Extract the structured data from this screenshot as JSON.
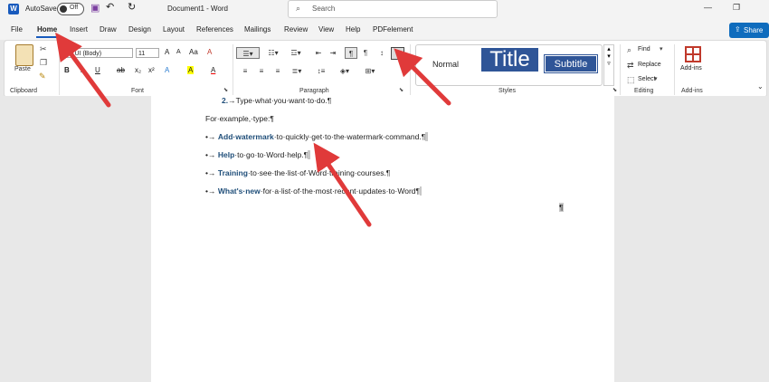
{
  "titlebar": {
    "autosave_label": "AutoSave",
    "autosave_state": "Off",
    "doc_title": "Document1 - Word",
    "search_placeholder": "Search",
    "undo": "↶",
    "redo": "↻",
    "minimize": "—",
    "restore": "❐"
  },
  "menu": {
    "tabs": [
      "File",
      "Home",
      "Insert",
      "Draw",
      "Design",
      "Layout",
      "References",
      "Mailings",
      "Review",
      "View",
      "Help",
      "PDFelement"
    ],
    "active": "Home",
    "share_label": "Share"
  },
  "ribbon": {
    "clipboard": {
      "label": "Clipboard",
      "paste_label": "Paste"
    },
    "font": {
      "label": "Font",
      "font_name": "Se UI (Body)",
      "font_size": "11",
      "buttons": [
        "B",
        "I",
        "U",
        "ab",
        "x₂",
        "x²",
        "A",
        "A",
        "A"
      ]
    },
    "paragraph": {
      "label": "Paragraph",
      "pilcrow": "¶"
    },
    "styles": {
      "label": "Styles",
      "normal": "Normal",
      "title": "Title",
      "subtitle": "Subtitle"
    },
    "editing": {
      "label": "Editing",
      "find": "Find",
      "replace": "Replace",
      "select": "Select"
    },
    "addins": {
      "label": "Add-ins",
      "button_label": "Add-ins"
    }
  },
  "document": {
    "numbered_item": {
      "number": "2.",
      "text": "→Type·what·you·want·to·do.¶"
    },
    "intro": "For·example,·type:¶",
    "bullets": [
      {
        "bold": "Add·watermark",
        "rest": "·to·quickly·get·to·the·watermark·command.¶"
      },
      {
        "bold": "Help",
        "rest": "·to·go·to·Word·help.¶"
      },
      {
        "bold": "Training",
        "rest": "·to·see·the·list·of·Word·training·courses.¶"
      },
      {
        "bold": "What's·new",
        "rest": "·for·a·list·of·the·most·recent·updates·to·Word¶"
      }
    ],
    "bullet_prefix": "•→",
    "stray_pilcrow": "¶"
  },
  "colors": {
    "accent": "#185abd",
    "arrow": "#e03a3a",
    "title_style": "#2f5597"
  },
  "icons": [
    "word-logo-icon",
    "save-icon",
    "undo-icon",
    "redo-icon",
    "search-icon",
    "paste-icon",
    "cut-icon",
    "copy-icon",
    "format-painter-icon",
    "pilcrow-icon",
    "find-icon",
    "replace-icon",
    "select-icon",
    "addins-icon"
  ]
}
